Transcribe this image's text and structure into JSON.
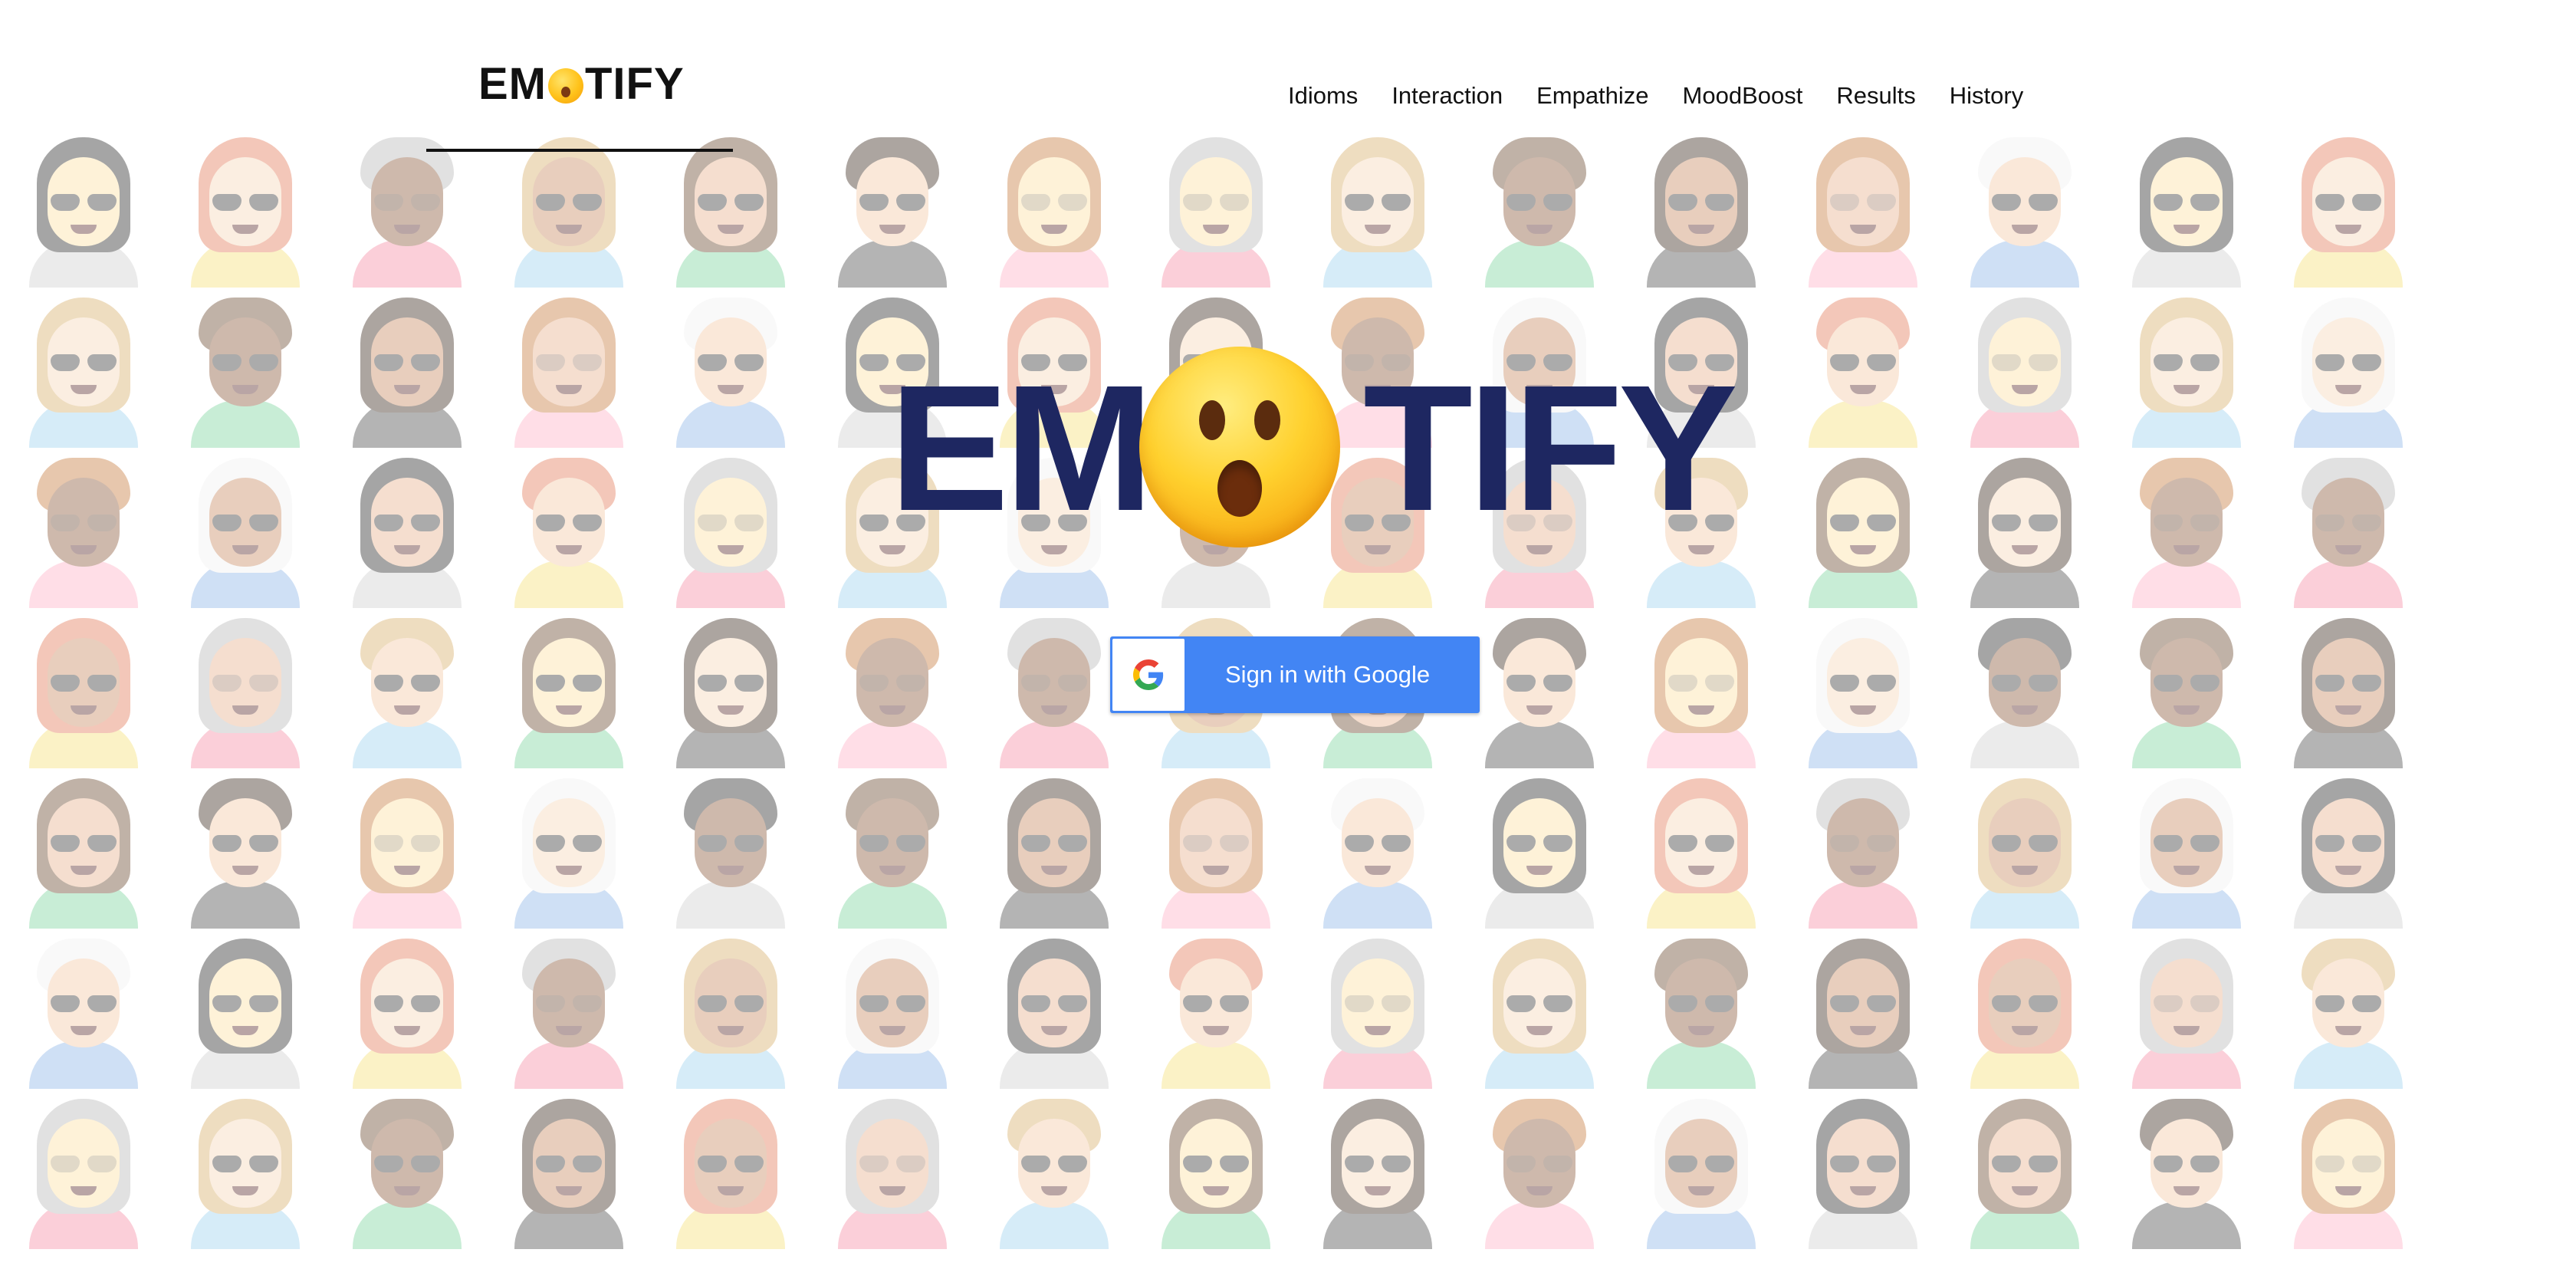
{
  "header": {
    "brand_left": "EM",
    "brand_right": "TIFY",
    "brand_emoji_icon": "astonished-face-icon"
  },
  "nav": {
    "items": [
      {
        "label": "Idioms"
      },
      {
        "label": "Interaction"
      },
      {
        "label": "Empathize"
      },
      {
        "label": "MoodBoost"
      },
      {
        "label": "Results"
      },
      {
        "label": "History"
      }
    ]
  },
  "hero": {
    "title_left": "EM",
    "title_right": "TIFY",
    "emoji_icon": "astonished-face-icon",
    "title_color": "#1e2761"
  },
  "auth": {
    "google_button_label": "Sign in with Google",
    "google_icon": "google-g-icon",
    "button_color": "#4285f4"
  },
  "background": {
    "pattern": "cartoon-avatar-grid"
  }
}
